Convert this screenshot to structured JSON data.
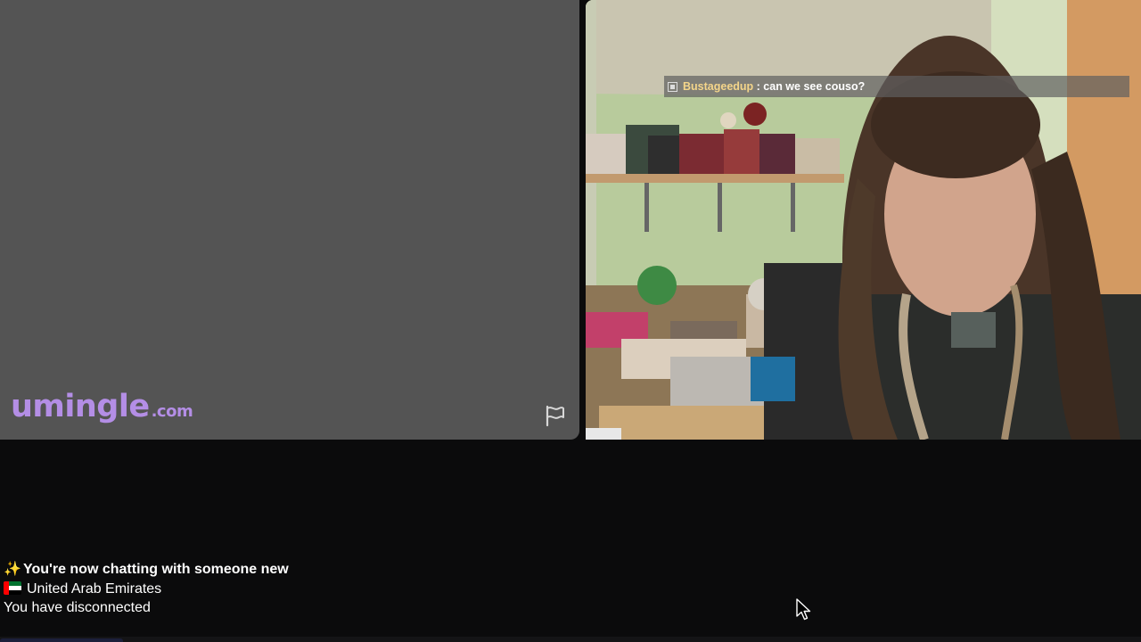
{
  "logo": {
    "main": "umingle",
    "tld": ".com"
  },
  "stranger_video": {
    "overlay": {
      "username": "Bustageedup",
      "separator": " : ",
      "message": "can we see couso?"
    }
  },
  "chat": {
    "lines": [
      {
        "icon": "sparkles-icon",
        "text": "You're now chatting with someone new"
      },
      {
        "icon": "uae-flag-icon",
        "text": "United Arab Emirates"
      },
      {
        "text": "You have disconnected"
      }
    ]
  },
  "icons": {
    "report": "flag-icon",
    "cursor": "mouse-pointer-icon"
  },
  "colors": {
    "brand": "#b48ee6",
    "background": "#0b0b0c",
    "self_video": "#545454",
    "username": "#f4d58a"
  }
}
